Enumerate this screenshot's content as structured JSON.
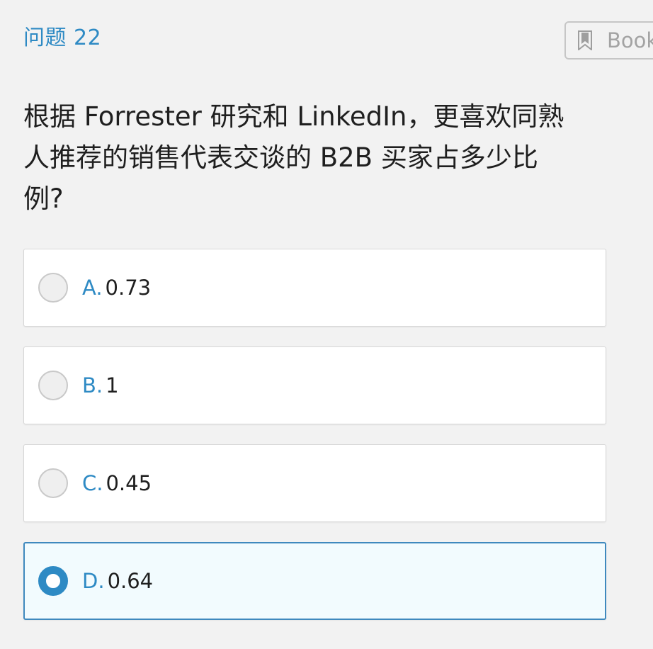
{
  "question_number": "问题 22",
  "bookmark_label": "Book",
  "question": {
    "line1": "根据 Forrester 研究和 LinkedIn，更喜欢同熟",
    "line2": "人推荐的销售代表交谈的 B2B 买家占多少比",
    "line3": "例?"
  },
  "options": [
    {
      "letter": "A.",
      "text": "0.73",
      "selected": false
    },
    {
      "letter": "B.",
      "text": "1",
      "selected": false
    },
    {
      "letter": "C.",
      "text": "0.45",
      "selected": false
    },
    {
      "letter": "D.",
      "text": "0.64",
      "selected": true
    }
  ],
  "colors": {
    "accent": "#2e8ac4",
    "selected_border": "#3f89be",
    "selected_bg": "#f2fbfe",
    "page_bg": "#f2f2f2"
  },
  "icons": {
    "bookmark": "bookmark-icon"
  }
}
